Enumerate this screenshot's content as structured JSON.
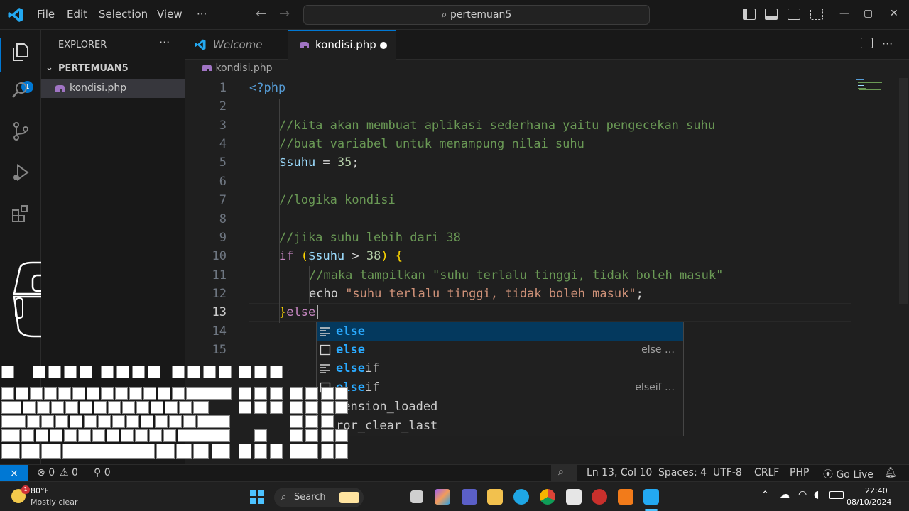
{
  "app": {
    "title": "pertemuan5",
    "menus": [
      "File",
      "Edit",
      "Selection",
      "View",
      "···"
    ]
  },
  "explorer": {
    "title": "EXPLORER",
    "more": "···",
    "folder": "PERTEMUAN5",
    "file": "kondisi.php",
    "badge": "1"
  },
  "tabs": [
    {
      "label": "Welcome",
      "active": false
    },
    {
      "label": "kondisi.php",
      "active": true,
      "dirty": true
    }
  ],
  "breadcrumb": "kondisi.php",
  "editor": {
    "lines": [
      "<?php",
      "",
      "//kita akan membuat aplikasi sederhana yaitu pengecekan suhu",
      "//buat variabel untuk menampung nilai suhu",
      "$suhu = 35;",
      "",
      "//logika kondisi",
      "",
      "//jika suhu lebih dari 38",
      "if ($suhu > 38) {",
      "//maka tampilkan \"suhu terlalu tinggi, tidak boleh masuk\"",
      "echo \"suhu terlalu tinggi, tidak boleh masuk\";",
      "}else",
      "",
      ""
    ],
    "current_line": 13
  },
  "suggestions": [
    {
      "match": "else",
      "rest": "",
      "detail": "",
      "icon": "snippet-icon",
      "selected": true
    },
    {
      "match": "else",
      "rest": "",
      "detail": "else …",
      "icon": "keyword-icon",
      "selected": false
    },
    {
      "match": "else",
      "rest": "if",
      "detail": "",
      "icon": "snippet-icon",
      "selected": false
    },
    {
      "match": "else",
      "rest": "if",
      "detail": "elseif …",
      "icon": "keyword-icon",
      "selected": false
    },
    {
      "match": "",
      "rest": "tension_loaded",
      "detail": "",
      "icon": "function-icon",
      "selected": false
    },
    {
      "match": "",
      "rest": "ror_clear_last",
      "detail": "",
      "icon": "function-icon",
      "selected": false
    }
  ],
  "status": {
    "errors": "0",
    "warnings": "0",
    "ports": "0",
    "position": "Ln 13, Col 10",
    "spaces": "Spaces: 4",
    "encoding": "UTF-8",
    "eol": "CRLF",
    "language": "PHP",
    "golive": "Go Live"
  },
  "taskbar": {
    "weather_temp": "80°F",
    "weather_desc": "Mostly clear",
    "weather_badge": "1",
    "search": "Search",
    "time": "22:40",
    "date": "08/10/2024"
  },
  "colors": {
    "accent": "#0078d4",
    "comment": "#6a9955",
    "keyword": "#c586c0",
    "variable": "#9cdcfe",
    "string": "#ce9178",
    "number": "#b5cea8",
    "tag": "#569cd6"
  }
}
